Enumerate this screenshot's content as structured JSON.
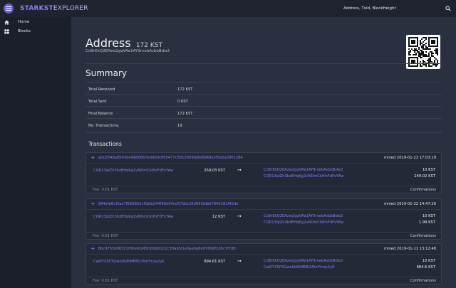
{
  "brand": {
    "part1": "STARKST",
    "part2": "EXPLORER"
  },
  "search": {
    "placeholder": "Address, TxId, BlockHeight"
  },
  "sidebar": {
    "items": [
      {
        "label": "Home",
        "icon": "home-icon"
      },
      {
        "label": "Blocks",
        "icon": "blocks-icon"
      }
    ]
  },
  "address": {
    "title": "Address",
    "balance": "172 KST",
    "hash": "Cd9rEkQ2EAzw2gqVAe1AY9rvebAvbbBdw2"
  },
  "summary": {
    "title": "Summary",
    "rows": [
      {
        "label": "Total Received",
        "value": "172 KST"
      },
      {
        "label": "Total Sent",
        "value": "0 KST"
      },
      {
        "label": "Final Balance",
        "value": "172 KST"
      },
      {
        "label": "No. Transactions",
        "value": "19"
      }
    ]
  },
  "transactions": {
    "title": "Transactions",
    "confirmations_label": "Confirmations",
    "items": [
      {
        "hash": "ab1854da85430e4980667ed9d9c895477c3012609fe8e6849e3f5a5a3901284",
        "mined": "mined 2019-01-23 17:03:19",
        "from": "CQR13qlZh3bzEHqKg2vNDmCktPsFdFxYAw",
        "amount": "259.03 KST",
        "outputs": [
          {
            "to": "Cd9rEkQ2EAzw2gqVAe1AY9rvebAvbbBdw2",
            "value": "10 KST"
          },
          {
            "to": "CQR13qlZh3bzEHqKg2vNDmCktPsFdFxYAw",
            "value": "249.02 KST"
          }
        ],
        "fee": "Fee: 0.01 KST"
      },
      {
        "hash": "994efb6c1faa7f825852cffabb244f99e04cd57dbc28d69fddb67845281f42de",
        "mined": "mined 2019-01-22 14:47:20",
        "from": "CQR13qlZh3bzEHqKg2vNDmCktPsFdFxYAw",
        "amount": "12 KST",
        "outputs": [
          {
            "to": "Cd9rEkQ2EAzw2gqVAe1AY9rvebAvbbBdw2",
            "value": "10 KST"
          },
          {
            "to": "CQR13qlZh3bzEHqKg2vNDmCktPsFdFxYAw",
            "value": "1.99 KST"
          }
        ],
        "fee": "Fee: 0.01 KST"
      },
      {
        "hash": "8bc9753dd6522f00e6f24502ddbf2c2c3ffab5l1e0ae0e8e97699f1d6c7f7d8",
        "mined": "mined 2019-01-11 13:12:48",
        "from": "CaWYX5F3Gwo0k8tMEBi1fXztYnzy2yK",
        "amount": "894.61 KST",
        "outputs": [
          {
            "to": "Cd9rEkQ2EAzw2gqVAe1AY9rvebAvbbBdw2",
            "value": "10 KST"
          },
          {
            "to": "CaWYX5F3Gwo0k8tMEBi1fXztYnzy2yK",
            "value": "884.6 KST"
          }
        ],
        "fee": "Fee: 0.01 KST"
      }
    ]
  }
}
